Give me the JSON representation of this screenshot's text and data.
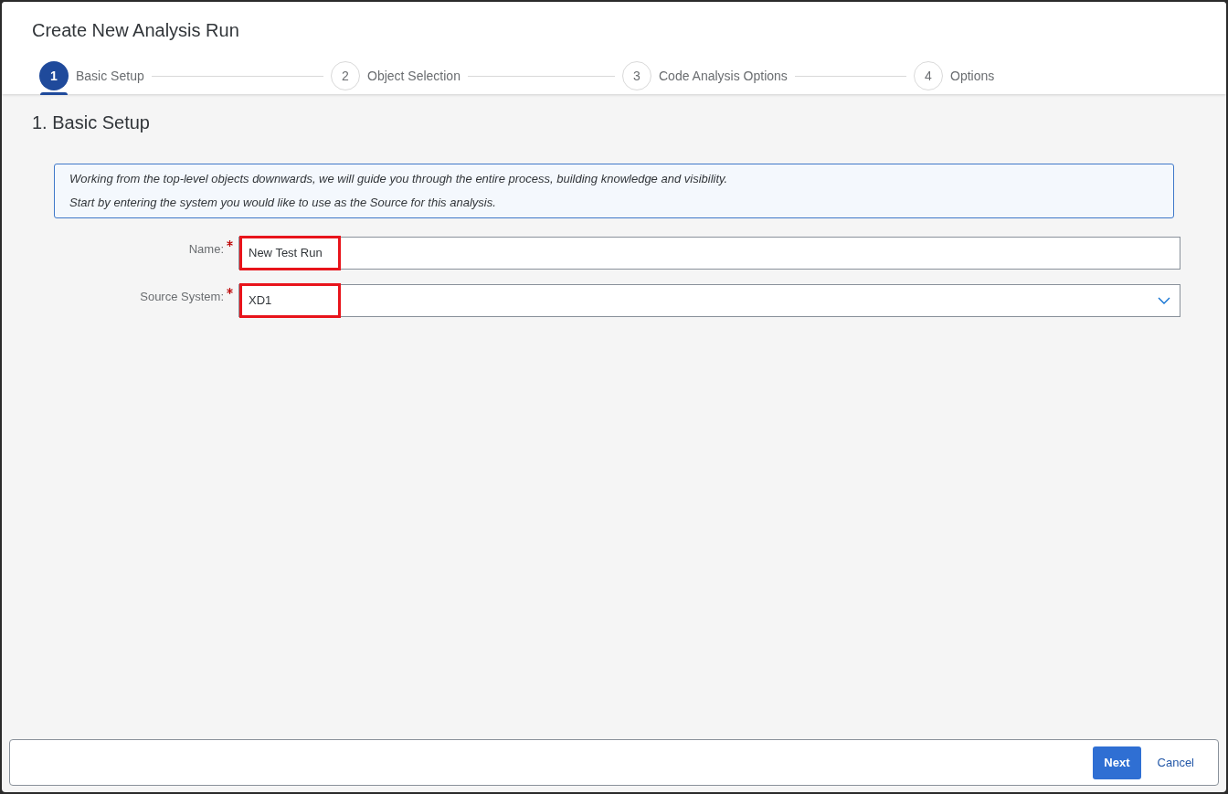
{
  "dialog": {
    "title": "Create New Analysis Run"
  },
  "steps": [
    {
      "number": "1",
      "label": "Basic Setup",
      "selected": true
    },
    {
      "number": "2",
      "label": "Object Selection",
      "selected": false
    },
    {
      "number": "3",
      "label": "Code Analysis Options",
      "selected": false
    },
    {
      "number": "4",
      "label": "Options",
      "selected": false
    }
  ],
  "section_title": "1. Basic Setup",
  "info_box": {
    "lines": [
      "Working from the top-level objects downwards, we will guide you through the entire process, building knowledge and visibility.",
      "Start by entering the system you would like to use as the Source for this analysis."
    ]
  },
  "fields": [
    {
      "kind": "text",
      "label": "Name:",
      "required": true,
      "value": "New Test Run",
      "highlighted": true
    },
    {
      "kind": "select",
      "label": "Source System:",
      "required": true,
      "value": "XD1",
      "highlighted": true
    }
  ],
  "footer": {
    "buttons": [
      {
        "kind": "primary",
        "label": "Next"
      },
      {
        "kind": "link",
        "label": "Cancel"
      }
    ]
  }
}
